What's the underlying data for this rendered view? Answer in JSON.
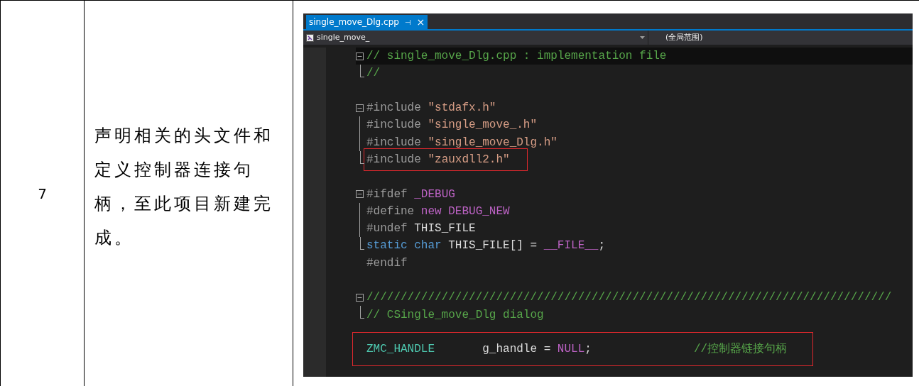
{
  "table": {
    "step": "7",
    "description": "声明相关的头文件和定义控制器连接句柄，至此项目新建完成。"
  },
  "ide": {
    "tab": {
      "title": "single_move_Dlg.cpp",
      "pin": "⊣",
      "close": "×",
      "selected": true
    },
    "nav": {
      "scope": "single_move_",
      "member": "(全局范围)"
    },
    "lines": [
      {
        "collapsible": true,
        "guide": false,
        "guide_end": false,
        "current": true,
        "highlighted": false,
        "tokens": [
          {
            "kind": "comment",
            "text": "// single_move_Dlg.cpp : implementation file"
          }
        ]
      },
      {
        "collapsible": false,
        "guide": false,
        "guide_end": true,
        "current": false,
        "highlighted": false,
        "tokens": [
          {
            "kind": "comment",
            "text": "//"
          }
        ]
      },
      {
        "collapsible": false,
        "guide": false,
        "guide_end": false,
        "current": false,
        "highlighted": false
      },
      {
        "collapsible": true,
        "guide": false,
        "guide_end": false,
        "current": false,
        "highlighted": false,
        "tokens": [
          {
            "kind": "directive",
            "text": "#include "
          },
          {
            "kind": "string",
            "text": "\"stdafx.h\""
          }
        ]
      },
      {
        "collapsible": false,
        "guide": true,
        "guide_end": false,
        "current": false,
        "highlighted": false,
        "tokens": [
          {
            "kind": "directive",
            "text": "#include "
          },
          {
            "kind": "string",
            "text": "\"single_move_.h\""
          }
        ]
      },
      {
        "collapsible": false,
        "guide": true,
        "guide_end": false,
        "current": false,
        "highlighted": false,
        "tokens": [
          {
            "kind": "directive",
            "text": "#include "
          },
          {
            "kind": "string",
            "text": "\"single_move_Dlg.h\""
          }
        ]
      },
      {
        "collapsible": false,
        "guide": false,
        "guide_end": true,
        "current": false,
        "highlighted": true,
        "tokens": [
          {
            "kind": "directive",
            "text": "#include "
          },
          {
            "kind": "string",
            "text": "\"zauxdll2.h\""
          }
        ]
      },
      {
        "collapsible": false,
        "guide": false,
        "guide_end": false,
        "current": false,
        "highlighted": false
      },
      {
        "collapsible": true,
        "guide": false,
        "guide_end": false,
        "current": false,
        "highlighted": false,
        "tokens": [
          {
            "kind": "directive",
            "text": "#ifdef "
          },
          {
            "kind": "macro",
            "text": "_DEBUG"
          }
        ]
      },
      {
        "collapsible": false,
        "guide": true,
        "guide_end": false,
        "current": false,
        "highlighted": false,
        "tokens": [
          {
            "kind": "directive",
            "text": "#define "
          },
          {
            "kind": "macro",
            "text": "new DEBUG_NEW"
          }
        ]
      },
      {
        "collapsible": false,
        "guide": true,
        "guide_end": false,
        "current": false,
        "highlighted": false,
        "tokens": [
          {
            "kind": "directive",
            "text": "#undef "
          },
          {
            "kind": "plain",
            "text": "THIS_FILE"
          }
        ]
      },
      {
        "collapsible": false,
        "guide": false,
        "guide_end": true,
        "current": false,
        "highlighted": false,
        "tokens": [
          {
            "kind": "keyword",
            "text": "static char "
          },
          {
            "kind": "plain",
            "text": "THIS_FILE[] = "
          },
          {
            "kind": "macro",
            "text": "__FILE__"
          },
          {
            "kind": "plain",
            "text": ";"
          }
        ]
      },
      {
        "collapsible": false,
        "guide": false,
        "guide_end": false,
        "current": false,
        "highlighted": false,
        "tokens": [
          {
            "kind": "directive",
            "text": "#endif"
          }
        ]
      },
      {
        "collapsible": false,
        "guide": false,
        "guide_end": false,
        "current": false,
        "highlighted": false
      },
      {
        "collapsible": true,
        "guide": false,
        "guide_end": false,
        "current": false,
        "highlighted": false,
        "tokens": [
          {
            "kind": "comment",
            "text": "/////////////////////////////////////////////////////////////////////////////"
          }
        ]
      },
      {
        "collapsible": false,
        "guide": false,
        "guide_end": true,
        "current": false,
        "highlighted": false,
        "tokens": [
          {
            "kind": "comment",
            "text": "// CSingle_move_Dlg dialog"
          }
        ]
      },
      {
        "collapsible": false,
        "guide": false,
        "guide_end": false,
        "current": false,
        "highlighted": false
      },
      {
        "collapsible": false,
        "guide": false,
        "guide_end": false,
        "current": false,
        "highlighted": true,
        "tokens": [
          {
            "kind": "type",
            "text": "ZMC_HANDLE"
          },
          {
            "kind": "plain",
            "text": "       g_handle = "
          },
          {
            "kind": "macro",
            "text": "NULL"
          },
          {
            "kind": "plain",
            "text": ";"
          },
          {
            "kind": "comment",
            "text": "               //控制器链接句柄"
          }
        ]
      }
    ]
  }
}
